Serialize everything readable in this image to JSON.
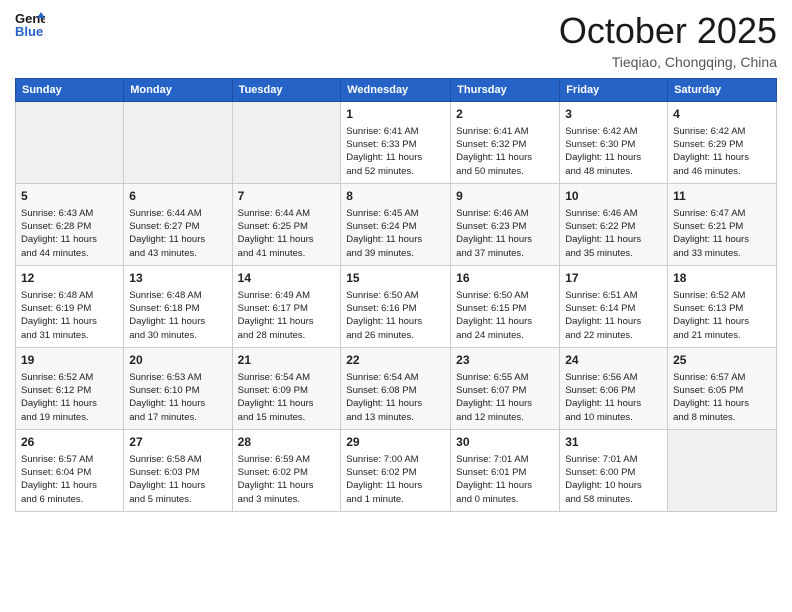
{
  "logo": {
    "line1": "General",
    "line2": "Blue"
  },
  "title": "October 2025",
  "subtitle": "Tieqiao, Chongqing, China",
  "headers": [
    "Sunday",
    "Monday",
    "Tuesday",
    "Wednesday",
    "Thursday",
    "Friday",
    "Saturday"
  ],
  "weeks": [
    [
      {
        "day": "",
        "content": ""
      },
      {
        "day": "",
        "content": ""
      },
      {
        "day": "",
        "content": ""
      },
      {
        "day": "1",
        "content": "Sunrise: 6:41 AM\nSunset: 6:33 PM\nDaylight: 11 hours\nand 52 minutes."
      },
      {
        "day": "2",
        "content": "Sunrise: 6:41 AM\nSunset: 6:32 PM\nDaylight: 11 hours\nand 50 minutes."
      },
      {
        "day": "3",
        "content": "Sunrise: 6:42 AM\nSunset: 6:30 PM\nDaylight: 11 hours\nand 48 minutes."
      },
      {
        "day": "4",
        "content": "Sunrise: 6:42 AM\nSunset: 6:29 PM\nDaylight: 11 hours\nand 46 minutes."
      }
    ],
    [
      {
        "day": "5",
        "content": "Sunrise: 6:43 AM\nSunset: 6:28 PM\nDaylight: 11 hours\nand 44 minutes."
      },
      {
        "day": "6",
        "content": "Sunrise: 6:44 AM\nSunset: 6:27 PM\nDaylight: 11 hours\nand 43 minutes."
      },
      {
        "day": "7",
        "content": "Sunrise: 6:44 AM\nSunset: 6:25 PM\nDaylight: 11 hours\nand 41 minutes."
      },
      {
        "day": "8",
        "content": "Sunrise: 6:45 AM\nSunset: 6:24 PM\nDaylight: 11 hours\nand 39 minutes."
      },
      {
        "day": "9",
        "content": "Sunrise: 6:46 AM\nSunset: 6:23 PM\nDaylight: 11 hours\nand 37 minutes."
      },
      {
        "day": "10",
        "content": "Sunrise: 6:46 AM\nSunset: 6:22 PM\nDaylight: 11 hours\nand 35 minutes."
      },
      {
        "day": "11",
        "content": "Sunrise: 6:47 AM\nSunset: 6:21 PM\nDaylight: 11 hours\nand 33 minutes."
      }
    ],
    [
      {
        "day": "12",
        "content": "Sunrise: 6:48 AM\nSunset: 6:19 PM\nDaylight: 11 hours\nand 31 minutes."
      },
      {
        "day": "13",
        "content": "Sunrise: 6:48 AM\nSunset: 6:18 PM\nDaylight: 11 hours\nand 30 minutes."
      },
      {
        "day": "14",
        "content": "Sunrise: 6:49 AM\nSunset: 6:17 PM\nDaylight: 11 hours\nand 28 minutes."
      },
      {
        "day": "15",
        "content": "Sunrise: 6:50 AM\nSunset: 6:16 PM\nDaylight: 11 hours\nand 26 minutes."
      },
      {
        "day": "16",
        "content": "Sunrise: 6:50 AM\nSunset: 6:15 PM\nDaylight: 11 hours\nand 24 minutes."
      },
      {
        "day": "17",
        "content": "Sunrise: 6:51 AM\nSunset: 6:14 PM\nDaylight: 11 hours\nand 22 minutes."
      },
      {
        "day": "18",
        "content": "Sunrise: 6:52 AM\nSunset: 6:13 PM\nDaylight: 11 hours\nand 21 minutes."
      }
    ],
    [
      {
        "day": "19",
        "content": "Sunrise: 6:52 AM\nSunset: 6:12 PM\nDaylight: 11 hours\nand 19 minutes."
      },
      {
        "day": "20",
        "content": "Sunrise: 6:53 AM\nSunset: 6:10 PM\nDaylight: 11 hours\nand 17 minutes."
      },
      {
        "day": "21",
        "content": "Sunrise: 6:54 AM\nSunset: 6:09 PM\nDaylight: 11 hours\nand 15 minutes."
      },
      {
        "day": "22",
        "content": "Sunrise: 6:54 AM\nSunset: 6:08 PM\nDaylight: 11 hours\nand 13 minutes."
      },
      {
        "day": "23",
        "content": "Sunrise: 6:55 AM\nSunset: 6:07 PM\nDaylight: 11 hours\nand 12 minutes."
      },
      {
        "day": "24",
        "content": "Sunrise: 6:56 AM\nSunset: 6:06 PM\nDaylight: 11 hours\nand 10 minutes."
      },
      {
        "day": "25",
        "content": "Sunrise: 6:57 AM\nSunset: 6:05 PM\nDaylight: 11 hours\nand 8 minutes."
      }
    ],
    [
      {
        "day": "26",
        "content": "Sunrise: 6:57 AM\nSunset: 6:04 PM\nDaylight: 11 hours\nand 6 minutes."
      },
      {
        "day": "27",
        "content": "Sunrise: 6:58 AM\nSunset: 6:03 PM\nDaylight: 11 hours\nand 5 minutes."
      },
      {
        "day": "28",
        "content": "Sunrise: 6:59 AM\nSunset: 6:02 PM\nDaylight: 11 hours\nand 3 minutes."
      },
      {
        "day": "29",
        "content": "Sunrise: 7:00 AM\nSunset: 6:02 PM\nDaylight: 11 hours\nand 1 minute."
      },
      {
        "day": "30",
        "content": "Sunrise: 7:01 AM\nSunset: 6:01 PM\nDaylight: 11 hours\nand 0 minutes."
      },
      {
        "day": "31",
        "content": "Sunrise: 7:01 AM\nSunset: 6:00 PM\nDaylight: 10 hours\nand 58 minutes."
      },
      {
        "day": "",
        "content": ""
      }
    ]
  ]
}
